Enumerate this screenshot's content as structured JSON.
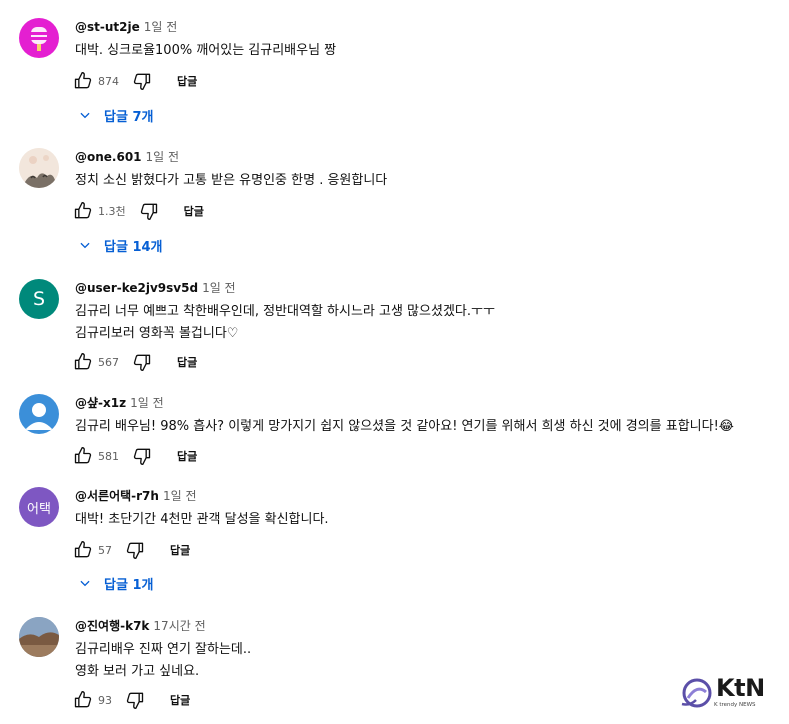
{
  "comments": [
    {
      "author": "@st-ut2je",
      "time": "1일 전",
      "lines": [
        "대박. 싱크로율100%  깨어있는 김규리배우님 짱"
      ],
      "likes": "874",
      "reply_label": "답글",
      "replies_label": "답글 7개",
      "avatar_icon": "popsicle-avatar-icon",
      "avatar_color": "#e41fd1"
    },
    {
      "author": "@one.601",
      "time": "1일 전",
      "lines": [
        "정치 소신 밝혔다가 고통 받은 유명인중 한명 . 응원합니다"
      ],
      "likes": "1.3천",
      "reply_label": "답글",
      "replies_label": "답글 14개",
      "avatar_icon": "cat-photo-avatar-icon",
      "avatar_color": "#f2e6dc"
    },
    {
      "author": "@user-ke2jv9sv5d",
      "time": "1일 전",
      "lines": [
        "김규리 너무 예쁘고 착한배우인데, 정반대역할 하시느라 고생 많으셨겠다.ㅜㅜ",
        "김규리보러 영화꼭 볼겁니다♡"
      ],
      "likes": "567",
      "reply_label": "답글",
      "avatar_letter": "S",
      "avatar_color": "#00897b"
    },
    {
      "author": "@샾-x1z",
      "time": "1일 전",
      "lines": [
        "김규리 배우님! 98% 흡사? 이렇게 망가지기 쉽지 않으셨을 것 같아요! 연기를 위해서 희생 하신 것에 경의를 표합니다!😂"
      ],
      "likes": "581",
      "reply_label": "답글",
      "avatar_icon": "default-user-avatar-icon",
      "avatar_color": "#3b8fd9"
    },
    {
      "author": "@서른어택-r7h",
      "time": "1일 전",
      "lines": [
        "대박! 초단기간 4천만 관객 달성을 확신합니다."
      ],
      "likes": "57",
      "reply_label": "답글",
      "replies_label": "답글 1개",
      "avatar_letter": "어택",
      "avatar_color": "#7e57c2"
    },
    {
      "author": "@진여행-k7k",
      "time": "17시간 전",
      "lines": [
        "김규리배우 진짜 연기 잘하는데..",
        "영화 보러 가고 싶네요."
      ],
      "likes": "93",
      "reply_label": "답글",
      "avatar_icon": "landscape-photo-avatar-icon",
      "avatar_color": "#6d88a6"
    }
  ],
  "watermark": {
    "logo_text": "KtN",
    "tagline": "K trendy NEWS",
    "brand_color": "#5b4fa8"
  }
}
